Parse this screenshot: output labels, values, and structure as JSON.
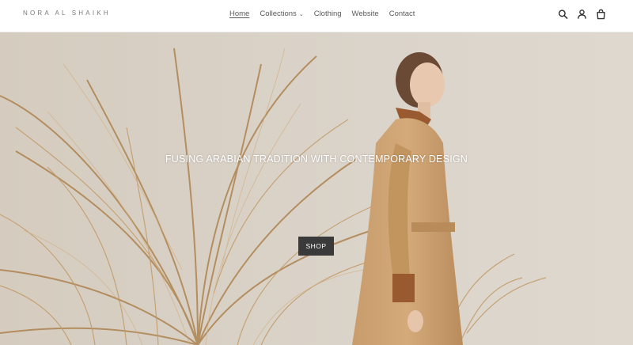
{
  "header": {
    "logo": "NORA AL SHAIKH",
    "nav": [
      {
        "label": "Home",
        "active": true
      },
      {
        "label": "Collections",
        "has_dropdown": true
      },
      {
        "label": "Clothing"
      },
      {
        "label": "Website"
      },
      {
        "label": "Contact"
      }
    ],
    "icons": [
      "search-icon",
      "account-icon",
      "cart-icon"
    ]
  },
  "hero": {
    "headline": "FUSING ARABIAN TRADITION WITH CONTEMPORARY DESIGN",
    "cta_label": "SHOP"
  },
  "colors": {
    "header_bg": "#ffffff",
    "button_bg": "#3a3a3a",
    "hero_bg": "#d9d1c6",
    "palm": "#b8915f",
    "coat": "#c79a6a"
  }
}
